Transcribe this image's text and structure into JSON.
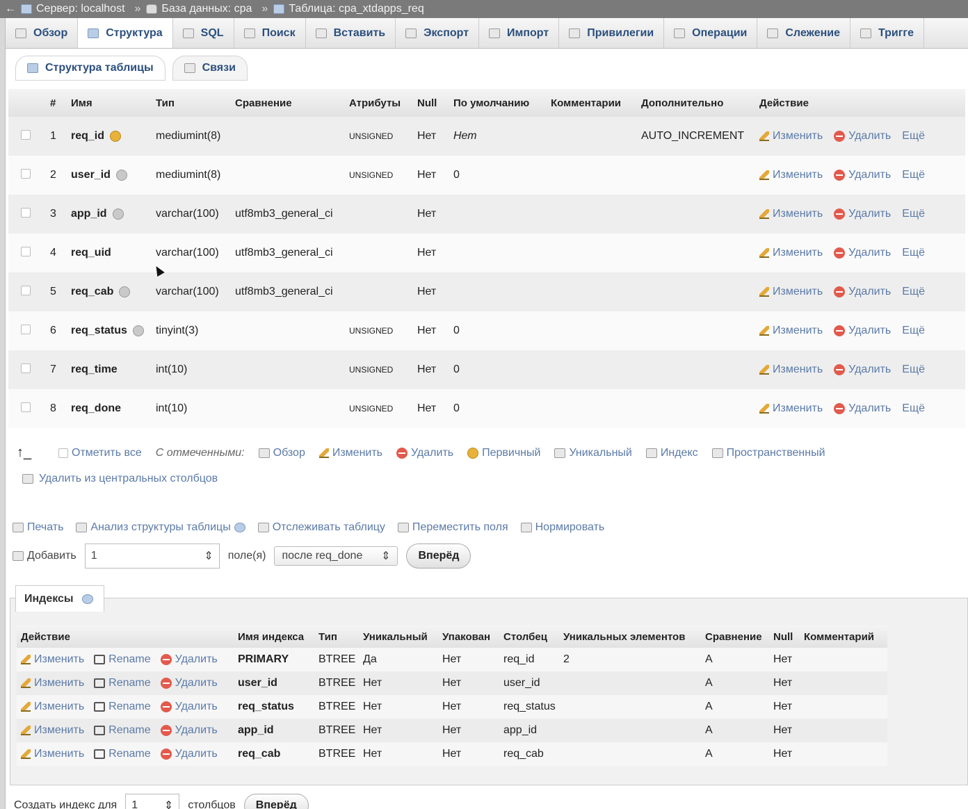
{
  "breadcrumb": {
    "server": "Сервер: localhost",
    "database": "База данных: cpa",
    "table": "Таблица: cpa_xtdapps_req",
    "separator": "»"
  },
  "tabs": [
    "Обзор",
    "Структура",
    "SQL",
    "Поиск",
    "Вставить",
    "Экспорт",
    "Импорт",
    "Привилегии",
    "Операции",
    "Слежение",
    "Тригге"
  ],
  "active_tab": "Структура",
  "subtabs": [
    "Структура таблицы",
    "Связи"
  ],
  "structure": {
    "headers": {
      "num": "#",
      "name": "Имя",
      "type": "Тип",
      "collation": "Сравнение",
      "attributes": "Атрибуты",
      "null": "Null",
      "default": "По умолчанию",
      "comments": "Комментарии",
      "extra": "Дополнительно",
      "action": "Действие"
    },
    "rows": [
      {
        "num": "1",
        "name": "req_id",
        "type": "mediumint(8)",
        "collation": "",
        "attributes": "UNSIGNED",
        "null": "Нет",
        "default": "Нет",
        "extra": "AUTO_INCREMENT"
      },
      {
        "num": "2",
        "name": "user_id",
        "type": "mediumint(8)",
        "collation": "",
        "attributes": "UNSIGNED",
        "null": "Нет",
        "default": "0",
        "extra": ""
      },
      {
        "num": "3",
        "name": "app_id",
        "type": "varchar(100)",
        "collation": "utf8mb3_general_ci",
        "attributes": "",
        "null": "Нет",
        "default": "",
        "extra": ""
      },
      {
        "num": "4",
        "name": "req_uid",
        "type": "varchar(100)",
        "collation": "utf8mb3_general_ci",
        "attributes": "",
        "null": "Нет",
        "default": "",
        "extra": ""
      },
      {
        "num": "5",
        "name": "req_cab",
        "type": "varchar(100)",
        "collation": "utf8mb3_general_ci",
        "attributes": "",
        "null": "Нет",
        "default": "",
        "extra": ""
      },
      {
        "num": "6",
        "name": "req_status",
        "type": "tinyint(3)",
        "collation": "",
        "attributes": "UNSIGNED",
        "null": "Нет",
        "default": "0",
        "extra": ""
      },
      {
        "num": "7",
        "name": "req_time",
        "type": "int(10)",
        "collation": "",
        "attributes": "UNSIGNED",
        "null": "Нет",
        "default": "0",
        "extra": ""
      },
      {
        "num": "8",
        "name": "req_done",
        "type": "int(10)",
        "collation": "",
        "attributes": "UNSIGNED",
        "null": "Нет",
        "default": "0",
        "extra": ""
      }
    ],
    "actions": {
      "edit": "Изменить",
      "delete": "Удалить",
      "more": "Ещё"
    }
  },
  "with_selected": {
    "check_all": "Отметить все",
    "label": "С отмеченными:",
    "browse": "Обзор",
    "edit": "Изменить",
    "delete": "Удалить",
    "primary": "Первичный",
    "unique": "Уникальный",
    "index": "Индекс",
    "spatial": "Пространственный",
    "remove_central": "Удалить из центральных столбцов"
  },
  "tools": {
    "print": "Печать",
    "analyze": "Анализ структуры таблицы",
    "track": "Отслеживать таблицу",
    "move_columns": "Переместить поля",
    "normalize": "Нормировать"
  },
  "add_columns": {
    "label": "Добавить",
    "count": "1",
    "fields_label": "поле(я)",
    "position": "после req_done",
    "go": "Вперёд"
  },
  "indexes": {
    "tab_label": "Индексы",
    "headers": {
      "action": "Действие",
      "key_name": "Имя индекса",
      "type": "Тип",
      "unique": "Уникальный",
      "packed": "Упакован",
      "column": "Столбец",
      "cardinality": "Уникальных элементов",
      "collation": "Сравнение",
      "null": "Null",
      "comment": "Комментарий"
    },
    "actions": {
      "edit": "Изменить",
      "rename": "Rename",
      "delete": "Удалить"
    },
    "rows": [
      {
        "key_name": "PRIMARY",
        "type": "BTREE",
        "unique": "Да",
        "packed": "Нет",
        "column": "req_id",
        "cardinality": "2",
        "collation": "A",
        "null": "Нет"
      },
      {
        "key_name": "user_id",
        "type": "BTREE",
        "unique": "Нет",
        "packed": "Нет",
        "column": "user_id",
        "cardinality": "",
        "collation": "A",
        "null": "Нет"
      },
      {
        "key_name": "req_status",
        "type": "BTREE",
        "unique": "Нет",
        "packed": "Нет",
        "column": "req_status",
        "cardinality": "",
        "collation": "A",
        "null": "Нет"
      },
      {
        "key_name": "app_id",
        "type": "BTREE",
        "unique": "Нет",
        "packed": "Нет",
        "column": "app_id",
        "cardinality": "",
        "collation": "A",
        "null": "Нет"
      },
      {
        "key_name": "req_cab",
        "type": "BTREE",
        "unique": "Нет",
        "packed": "Нет",
        "column": "req_cab",
        "cardinality": "",
        "collation": "A",
        "null": "Нет"
      }
    ]
  },
  "create_index": {
    "label": "Создать индекс для",
    "count": "1",
    "columns_label": "столбцов",
    "go": "Вперёд"
  }
}
